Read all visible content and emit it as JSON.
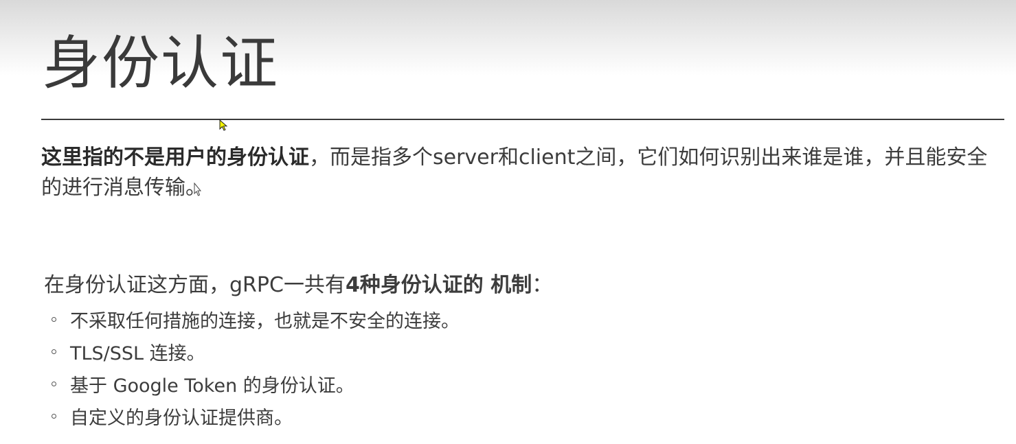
{
  "slide": {
    "title": "身份认证",
    "intro": {
      "lead": "这里指的不是用户的身份认证",
      "part1": "，而是指多个",
      "server": "server",
      "part2": "和",
      "client": "client",
      "part3": "之间，它们如何识别出来谁是谁，并且能安全的进行消息传输。"
    },
    "mechanisms_heading": {
      "prefix": "在身份认证这方面，",
      "grpc": "gRPC",
      "mid": "一共有",
      "bold": "4种身份认证的 机制",
      "suffix": "："
    },
    "mechanisms": [
      "不采取任何措施的连接，也就是不安全的连接。",
      "TLS/SSL 连接。",
      "基于 Google Token 的身份认证。",
      "自定义的身份认证提供商。"
    ]
  },
  "colors": {
    "text": "#3c3c3c",
    "rule": "#3a3a3a",
    "cursor_fill": "#f5f500"
  },
  "icons": [
    "mouse-pointer-icon",
    "text-cursor-icon",
    "bullet-circle-icon"
  ]
}
